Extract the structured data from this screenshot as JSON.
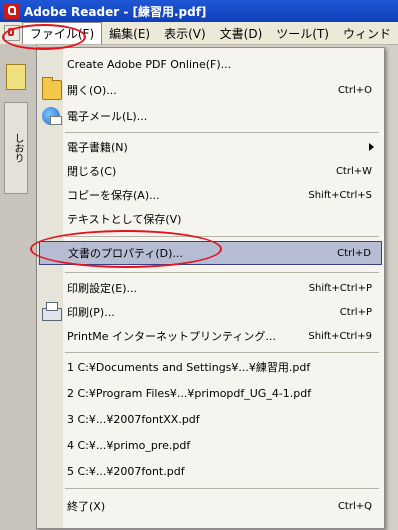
{
  "window": {
    "title": "Adobe Reader - [練習用.pdf]"
  },
  "menubar": {
    "items": [
      "ファイル(F)",
      "編集(E)",
      "表示(V)",
      "文書(D)",
      "ツール(T)",
      "ウィンド"
    ]
  },
  "sidebar": {
    "tab_label": "しおり"
  },
  "file_menu": {
    "items": [
      {
        "label": "Create Adobe PDF Online(F)...",
        "shortcut": ""
      },
      {
        "label": "開く(O)...",
        "shortcut": "Ctrl+O",
        "icon": "open-folder-icon"
      },
      {
        "label": "電子メール(L)...",
        "shortcut": "",
        "icon": "email-icon"
      },
      {
        "label": "電子書籍(N)",
        "shortcut": "",
        "submenu": true
      },
      {
        "label": "閉じる(C)",
        "shortcut": "Ctrl+W"
      },
      {
        "label": "コピーを保存(A)...",
        "shortcut": "Shift+Ctrl+S"
      },
      {
        "label": "テキストとして保存(V)",
        "shortcut": ""
      },
      {
        "label": "文書のプロパティ(D)...",
        "shortcut": "Ctrl+D",
        "highlighted": true
      },
      {
        "label": "印刷設定(E)...",
        "shortcut": "Shift+Ctrl+P"
      },
      {
        "label": "印刷(P)...",
        "shortcut": "Ctrl+P",
        "icon": "printer-icon"
      },
      {
        "label": "PrintMe インターネットプリンティング...",
        "shortcut": "Shift+Ctrl+9"
      },
      {
        "label": "1 C:¥Documents and Settings¥...¥練習用.pdf",
        "shortcut": ""
      },
      {
        "label": "2 C:¥Program Files¥...¥primopdf_UG_4-1.pdf",
        "shortcut": ""
      },
      {
        "label": "3 C:¥...¥2007fontXX.pdf",
        "shortcut": ""
      },
      {
        "label": "4 C:¥...¥primo_pre.pdf",
        "shortcut": ""
      },
      {
        "label": "5 C:¥...¥2007font.pdf",
        "shortcut": ""
      },
      {
        "label": "終了(X)",
        "shortcut": "Ctrl+Q"
      }
    ]
  },
  "colors": {
    "titlebar": "#1f57d6",
    "highlight": "#b6bdd2",
    "annotation": "#e3141d"
  }
}
